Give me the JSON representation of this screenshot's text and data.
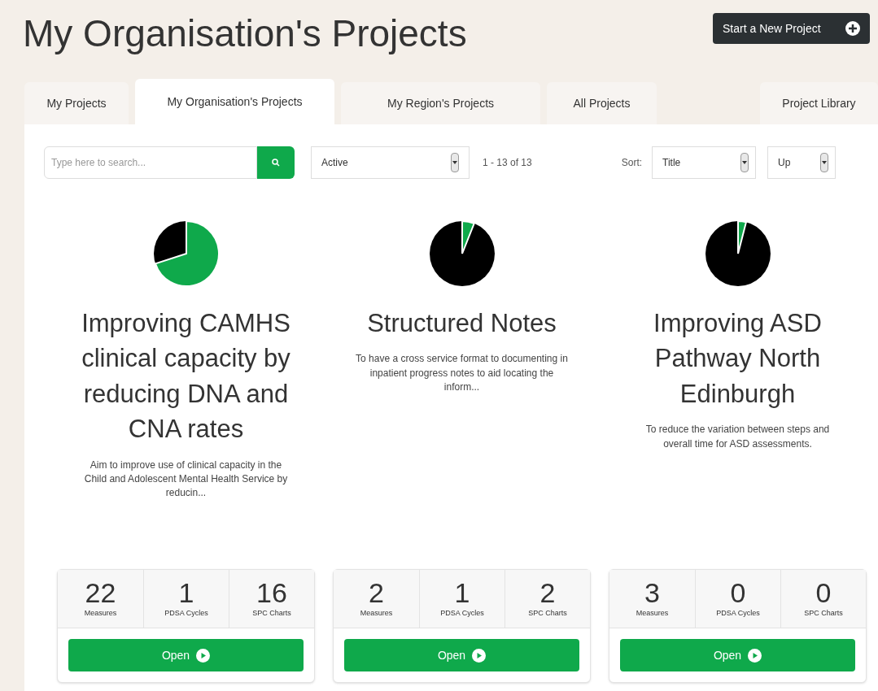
{
  "page_title": "My Organisation's Projects",
  "new_project_button": "Start a New Project",
  "tabs": [
    {
      "label": "My Projects",
      "selected": false
    },
    {
      "label": "My Organisation's Projects",
      "selected": true
    },
    {
      "label": "My Region's Projects",
      "selected": false
    },
    {
      "label": "All Projects",
      "selected": false
    },
    {
      "label": "Project Library",
      "selected": false
    }
  ],
  "search": {
    "placeholder": "Type here to search..."
  },
  "status_filter": "Active",
  "result_count": "1 - 13 of 13",
  "sort": {
    "label": "Sort:",
    "field": "Title",
    "direction": "Up"
  },
  "projects": [
    {
      "title": "Improving CAMHS clinical capacity by reducing DNA and CNA rates",
      "description": "Aim to improve use of clinical capacity in the Child and Adolescent Mental Health Service by reducin...",
      "stats": [
        {
          "value": "22",
          "label": "Measures"
        },
        {
          "value": "1",
          "label": "PDSA Cycles"
        },
        {
          "value": "16",
          "label": "SPC Charts"
        }
      ],
      "button": "Open"
    },
    {
      "title": "Structured Notes",
      "description": "To have a cross service format to documenting in inpatient progress notes to aid locating the inform...",
      "stats": [
        {
          "value": "2",
          "label": "Measures"
        },
        {
          "value": "1",
          "label": "PDSA Cycles"
        },
        {
          "value": "2",
          "label": "SPC Charts"
        }
      ],
      "button": "Open"
    },
    {
      "title": "Improving ASD Pathway North Edinburgh",
      "description": "To reduce the variation between steps and overall time for ASD assessments.",
      "stats": [
        {
          "value": "3",
          "label": "Measures"
        },
        {
          "value": "0",
          "label": "PDSA Cycles"
        },
        {
          "value": "0",
          "label": "SPC Charts"
        }
      ],
      "button": "Open"
    }
  ]
}
